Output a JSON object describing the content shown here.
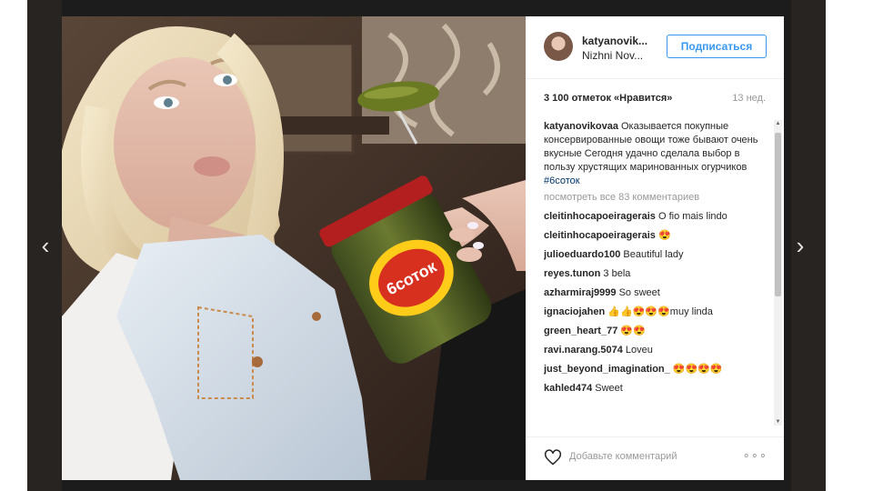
{
  "post": {
    "username": "katyanovik...",
    "location": "Nizhni Nov...",
    "follow_label": "Подписаться",
    "likes": "3 100 отметок «Нравится»",
    "time_ago": "13 нед.",
    "caption": {
      "author": "katyanovikovaa",
      "text": "Оказывается покупные консервированные овощи тоже бывают очень вкусные Сегодня удачно сделала выбор в пользу хрустящих маринованных огурчиков",
      "hashtag": "#6соток"
    },
    "view_all_comments": "посмотреть все 83 комментариев",
    "comments": [
      {
        "author": "cleitinhocapoeiragerais",
        "text": "O fio mais lindo"
      },
      {
        "author": "cleitinhocapoeiragerais",
        "text": "😍"
      },
      {
        "author": "julioeduardo100",
        "text": "Beautiful lady"
      },
      {
        "author": "reyes.tunon",
        "text": "3 bela"
      },
      {
        "author": "azharmiraj9999",
        "text": "So sweet"
      },
      {
        "author": "ignaciojahen",
        "text": "👍👍😍😍😍muy linda"
      },
      {
        "author": "green_heart_77",
        "text": "😍😍"
      },
      {
        "author": "ravi.narang.5074",
        "text": "Loveu"
      },
      {
        "author": "just_beyond_imagination_",
        "text": "😍😍😍😍"
      },
      {
        "author": "kahled474",
        "text": "Sweet"
      }
    ],
    "add_comment_placeholder": "Добавьте комментарий",
    "more_label": "∘∘∘",
    "jar_label": "6соток"
  },
  "icons": {
    "prev": "chevron-left-icon",
    "next": "chevron-right-icon",
    "like": "heart-icon"
  },
  "colors": {
    "follow_blue": "#3897f0",
    "hashtag_blue": "#003569",
    "muted_gray": "#999999"
  }
}
